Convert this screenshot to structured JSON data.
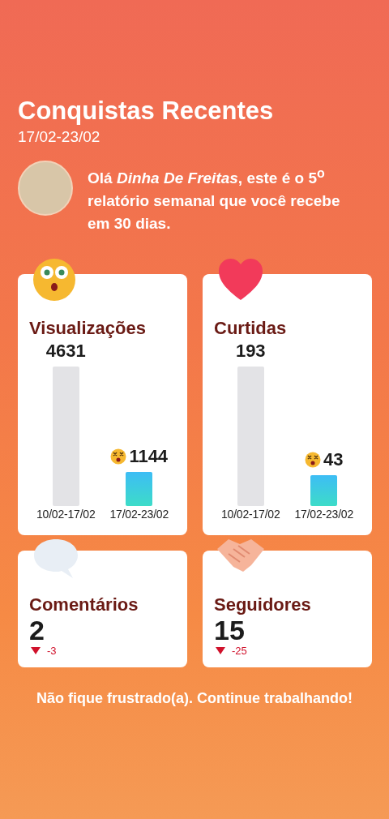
{
  "header": {
    "title": "Conquistas Recentes",
    "date_range": "17/02-23/02"
  },
  "greeting": {
    "text": "Olá *Dinha De Freitas*, este é o **5**$^{o}$ relatório semanal que você recebe em 30 dias."
  },
  "chart_cards": [
    {
      "kind": "face",
      "title": "Visualizações",
      "chart_data": {
        "type": "bar",
        "categories": [
          "10/02-17/02",
          "17/02-23/02"
        ],
        "series": [
          {
            "values": [
              4631,
              1144
            ]
          }
        ],
        "data_labels": true
      },
      "value_labels": [
        "4631",
        "1144"
      ]
    },
    {
      "kind": "heart",
      "title": "Curtidas",
      "chart_data": {
        "type": "bar",
        "categories": [
          "10/02-17/02",
          "17/02-23/02"
        ],
        "series": [
          {
            "values": [
              193,
              43
            ]
          }
        ],
        "data_labels": true
      },
      "value_labels": [
        "193",
        "43"
      ]
    }
  ],
  "stat_cards": [
    {
      "kind": "bubble",
      "title": "Comentários",
      "value": "2",
      "change": "-3"
    },
    {
      "kind": "handshake",
      "title": "Seguidores",
      "value": "15",
      "change": "-25"
    }
  ],
  "footer": "Não fique frustrado(a). Continue trabalhando!"
}
